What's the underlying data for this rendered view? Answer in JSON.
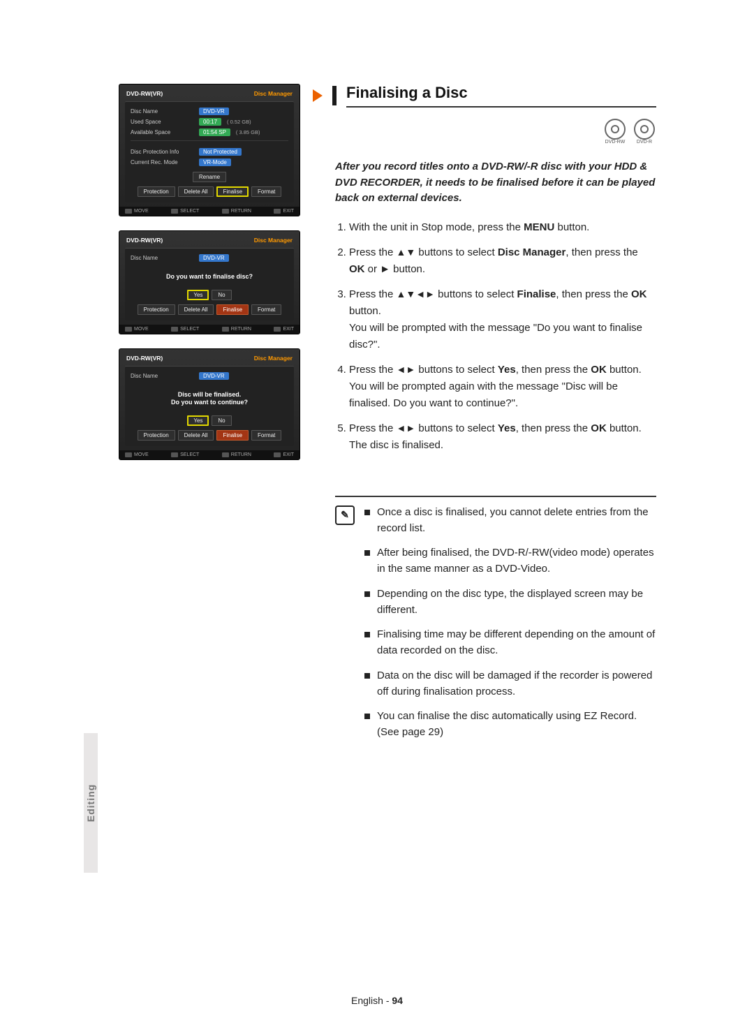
{
  "sideTab": "Editing",
  "section": {
    "title": "Finalising a Disc",
    "intro": "After you record titles onto a DVD-RW/-R disc with your HDD & DVD RECORDER, it needs to be finalised before it can be played back on external devices.",
    "discIcons": [
      "DVD-RW",
      "DVD-R"
    ]
  },
  "steps": {
    "s1_pre": "With the unit in Stop mode, press the ",
    "s1_btn": "MENU",
    "s1_post": " button.",
    "s2_pre": "Press the ",
    "s2_arrows": "▲▼",
    "s2_mid": " buttons to select ",
    "s2_sel": "Disc Manager",
    "s2_mid2": ", then press the ",
    "s2_ok": "OK",
    "s2_post": " or ► button.",
    "s3_pre": "Press the ",
    "s3_arrows": "▲▼◄►",
    "s3_mid": " buttons to select ",
    "s3_sel": "Finalise",
    "s3_mid2": ", then press the ",
    "s3_ok": "OK",
    "s3_post": " button.",
    "s3_extra": "You will be prompted with the message \"Do you want to finalise disc?\".",
    "s4_pre": "Press the ",
    "s4_arrows": "◄►",
    "s4_mid": " buttons to select ",
    "s4_sel": "Yes",
    "s4_mid2": ", then press the ",
    "s4_ok": "OK",
    "s4_post": " button.",
    "s4_extra": "You will be prompted again with the message \"Disc will be finalised. Do you want to continue?\".",
    "s5_pre": "Press the ",
    "s5_arrows": "◄►",
    "s5_mid": " buttons to select ",
    "s5_sel": "Yes",
    "s5_mid2": ", then press the ",
    "s5_ok": "OK",
    "s5_post": " button.",
    "s5_extra": "The disc is finalised."
  },
  "notes": [
    "Once a disc is finalised, you cannot delete entries from the record list.",
    "After being finalised, the DVD-R/-RW(video mode) operates in the same manner as a DVD-Video.",
    "Depending on the disc type, the displayed screen may be different.",
    "Finalising time may be different depending on the amount of data recorded on the disc.",
    "Data on the disc will be damaged if the recorder is powered off during finalisation process.",
    "You can finalise the disc automatically using EZ Record. (See page 29)"
  ],
  "osd": {
    "titleLeft": "DVD-RW(VR)",
    "titleRight": "Disc Manager",
    "rows": {
      "discName": {
        "label": "Disc Name",
        "value": "DVD-VR"
      },
      "usedSpace": {
        "label": "Used Space",
        "value": "00:17",
        "extra": "( 0.52 GB)"
      },
      "availSpace": {
        "label": "Available Space",
        "value": "01:54  SP",
        "extra": "( 3.85 GB)"
      },
      "protInfo": {
        "label": "Disc Protection Info",
        "value": "Not Protected"
      },
      "recMode": {
        "label": "Current Rec. Mode",
        "value": "VR-Mode"
      }
    },
    "rename": "Rename",
    "btns": [
      "Protection",
      "Delete All",
      "Finalise",
      "Format"
    ],
    "modal2": {
      "text": "Do you want to finalise disc?",
      "yes": "Yes",
      "no": "No"
    },
    "modal3": {
      "text1": "Disc will be finalised.",
      "text2": "Do you want to continue?",
      "yes": "Yes",
      "no": "No"
    },
    "hints": {
      "move": "MOVE",
      "select": "SELECT",
      "return": "RETURN",
      "exit": "EXIT"
    }
  },
  "footer": {
    "lang": "English",
    "page": "94"
  }
}
